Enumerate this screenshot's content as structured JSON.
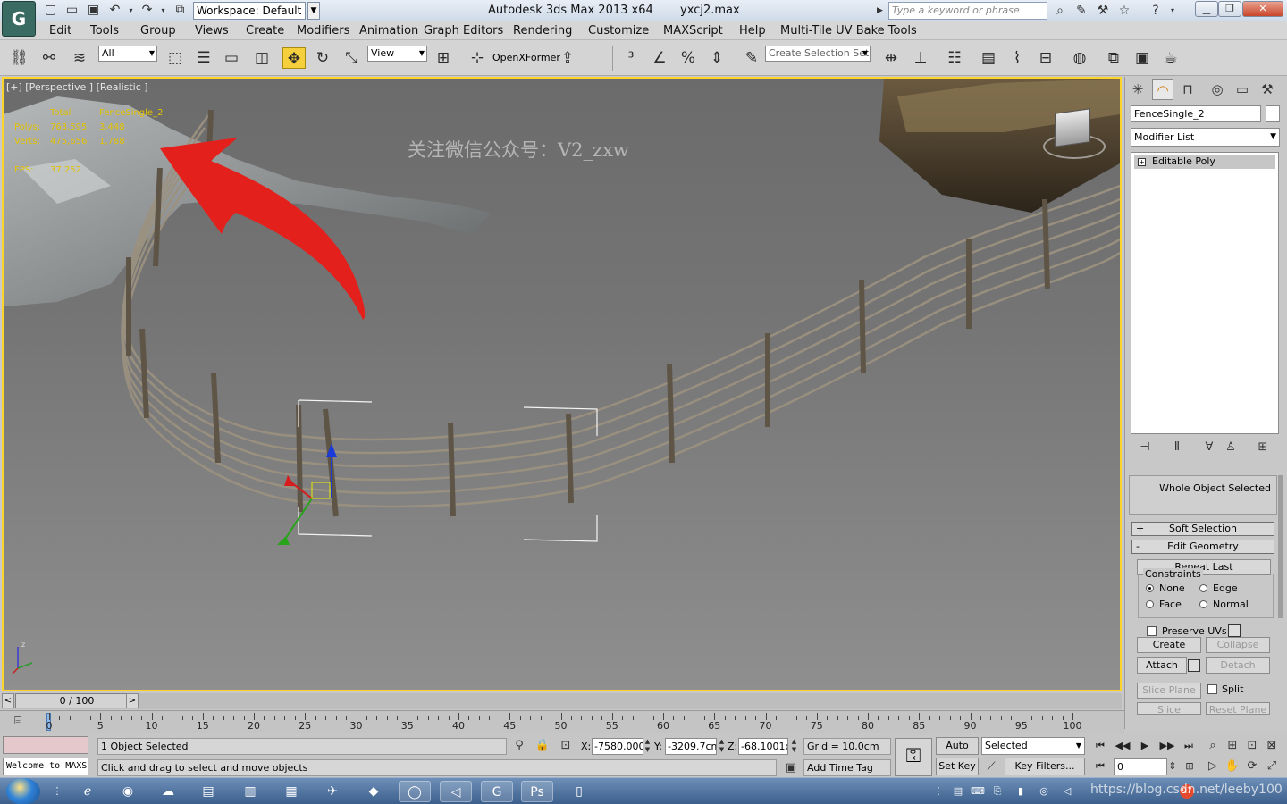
{
  "window": {
    "title": "Autodesk 3ds Max  2013 x64",
    "file": "yxcj2.max",
    "workspace": "Workspace: Default",
    "search_placeholder": "Type a keyword or phrase"
  },
  "menu": [
    "Edit",
    "Tools",
    "Group",
    "Views",
    "Create",
    "Modifiers",
    "Animation",
    "Graph Editors",
    "Rendering",
    "Customize",
    "MAXScript",
    "Help",
    "Multi-Tile UV Bake Tools"
  ],
  "toolbar": {
    "selection_filter": "All",
    "ref_coord": "View",
    "openxformer_label": "OpenXFormer",
    "named_selection_placeholder": "Create Selection Set"
  },
  "viewport": {
    "label": "[+] [Perspective ] [Realistic ]",
    "stats": {
      "col_total": "Total",
      "col_object": "FenceSingle_2",
      "polys_label": "Polys:",
      "polys_total": "763,595",
      "polys_object": "3,448",
      "verts_label": "Verts:",
      "verts_total": "475,656",
      "verts_object": "1,788",
      "fps_label": "FPS:",
      "fps_value": "37.252"
    },
    "watermark": "关注微信公众号：V2_zxw",
    "annotation_color": "#e3201b",
    "active_border_color": "#ffd42a"
  },
  "command_panel": {
    "object_name": "FenceSingle_2",
    "modifier_list": "Modifier List",
    "stack_item": "Editable Poly",
    "selection_info": "Whole Object Selected",
    "rollouts": {
      "soft_selection": "Soft Selection",
      "edit_geometry": "Edit Geometry"
    },
    "repeat_last": "Repeat Last",
    "constraints_label": "Constraints",
    "constraint_none": "None",
    "constraint_edge": "Edge",
    "constraint_face": "Face",
    "constraint_normal": "Normal",
    "preserve_uvs": "Preserve UVs",
    "create": "Create",
    "collapse": "Collapse",
    "attach": "Attach",
    "detach": "Detach",
    "slice_plane": "Slice Plane",
    "split": "Split",
    "slice": "Slice",
    "reset_plane": "Reset Plane"
  },
  "timeline": {
    "position": "0 / 100",
    "ticks": [
      "0",
      "5",
      "10",
      "15",
      "20",
      "25",
      "30",
      "35",
      "40",
      "45",
      "50",
      "55",
      "60",
      "65",
      "70",
      "75",
      "80",
      "85",
      "90",
      "95",
      "100"
    ]
  },
  "status": {
    "welcome": "Welcome to MAXS",
    "selected": "1 Object Selected",
    "prompt": "Click and drag to select and move objects",
    "x_label": "X:",
    "x": "-7580.000",
    "y_label": "Y:",
    "y": "-3209.7cm",
    "z_label": "Z:",
    "z": "-68.1001cm",
    "grid": "Grid = 10.0cm",
    "add_time_tag": "Add Time Tag",
    "auto_key": "Auto Key",
    "set_key": "Set Key",
    "key_mode": "Selected",
    "key_filters": "Key Filters...",
    "frame": "0"
  },
  "taskbar": {
    "url": "https://blog.csdn.net/leeby100",
    "badge": "97"
  }
}
